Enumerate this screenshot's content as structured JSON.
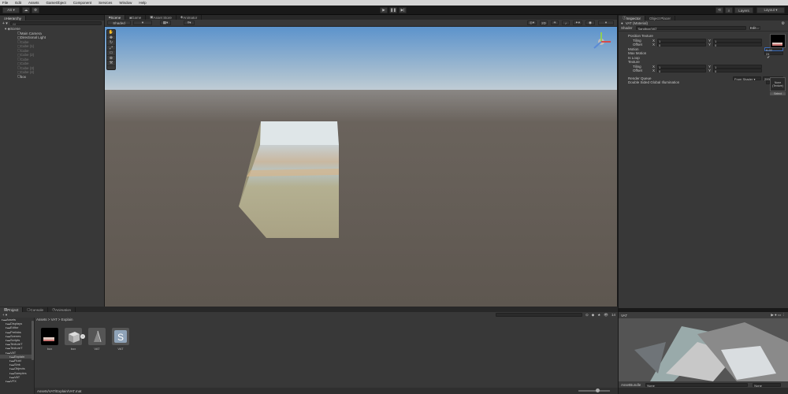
{
  "menu": [
    "File",
    "Edit",
    "Assets",
    "GameObject",
    "Component",
    "Services",
    "Window",
    "Help"
  ],
  "toolbar": {
    "account": "AS ▾",
    "layers": "Layers",
    "layout": "Layout ▾"
  },
  "hierarchy": {
    "tab": "Hierarchy",
    "search_placeholder": "All",
    "items": [
      {
        "label": "Scene",
        "indent": 0,
        "dim": false
      },
      {
        "label": "Main Camera",
        "indent": 1,
        "dim": false
      },
      {
        "label": "Directional Light",
        "indent": 1,
        "dim": false
      },
      {
        "label": "Cube",
        "indent": 1,
        "dim": true
      },
      {
        "label": "Cube (1)",
        "indent": 1,
        "dim": true
      },
      {
        "label": "Cube",
        "indent": 1,
        "dim": true
      },
      {
        "label": "Cube (2)",
        "indent": 1,
        "dim": true
      },
      {
        "label": "Cube",
        "indent": 1,
        "dim": true
      },
      {
        "label": "Cube",
        "indent": 1,
        "dim": true
      },
      {
        "label": "Cube (3)",
        "indent": 1,
        "dim": true
      },
      {
        "label": "Cube (4)",
        "indent": 1,
        "dim": true
      },
      {
        "label": "box",
        "indent": 1,
        "dim": false
      }
    ]
  },
  "scene": {
    "tabs": [
      "Scene",
      "Game",
      "Asset Store",
      "Animator"
    ],
    "shading": "Shaded",
    "mode": "2D",
    "gizmos": "Gizmos",
    "search": "All"
  },
  "inspector": {
    "tabs": [
      "Inspector",
      "Object Placer"
    ],
    "title": "VAT (Material)",
    "shader_label": "Shader",
    "shader_value": "Sandbox/VAT",
    "edit_label": "Edit...",
    "position_texture": "Position Texture",
    "tiling": "Tiling",
    "offset": "Offset",
    "tiling_x": "1",
    "tiling_y": "1",
    "offset_x": "0",
    "offset_y": "0",
    "motion_label": "Motion",
    "motion_value": "0.22",
    "max_motion_label": "Max Motion",
    "max_motion_value": "24",
    "is_loop_label": "Is Loop",
    "texture_label": "Texture",
    "none_texture": "None (Texture)",
    "select_label": "Select",
    "tiling2_x": "1",
    "tiling2_y": "1",
    "offset2_x": "0",
    "offset2_y": "0",
    "render_queue_label": "Render Queue",
    "render_queue_mode": "From Shader ▾",
    "render_queue_value": "2000",
    "double_sided_label": "Double Sided Global Illumination"
  },
  "preview": {
    "title": "VAT",
    "footer_label": "AssetBundle",
    "footer_value": "None",
    "footer_value2": "None"
  },
  "project": {
    "tabs": [
      "Project",
      "Console",
      "Animation"
    ],
    "tree": [
      {
        "label": "Assets",
        "indent": 0
      },
      {
        "label": "Displays",
        "indent": 1
      },
      {
        "label": "Editor",
        "indent": 1
      },
      {
        "label": "Prefabs",
        "indent": 1
      },
      {
        "label": "Scenes",
        "indent": 1
      },
      {
        "label": "Scripts",
        "indent": 1
      },
      {
        "label": "TextureT",
        "indent": 1
      },
      {
        "label": "TextureT",
        "indent": 1
      },
      {
        "label": "VAT",
        "indent": 1
      },
      {
        "label": "Explain",
        "indent": 2
      },
      {
        "label": "Fluid",
        "indent": 2
      },
      {
        "label": "Sink",
        "indent": 2
      },
      {
        "label": "Objects",
        "indent": 2
      },
      {
        "label": "Samples",
        "indent": 2
      },
      {
        "label": "VAT",
        "indent": 2
      },
      {
        "label": "VFX",
        "indent": 1
      }
    ],
    "breadcrumb": "Assets > VAT > Explain",
    "assets": [
      {
        "label": "box"
      },
      {
        "label": "box"
      },
      {
        "label": "VAT"
      },
      {
        "label": "VAT"
      }
    ],
    "status_path": "Assets/VAT/Explain/VAT.mat",
    "count": "14"
  },
  "colors": {
    "accent": "#3d6fbf",
    "sky_top": "#5c93cc",
    "ground": "#645c55",
    "cube_front": "#aaa385",
    "cube_side": "#9a9478"
  }
}
